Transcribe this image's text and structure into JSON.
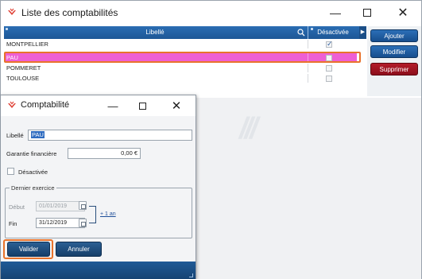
{
  "main_window": {
    "title": "Liste des comptabilités",
    "controls": {
      "minimize": "—",
      "close": "✕"
    }
  },
  "grid": {
    "columns": {
      "libelle": "Libellé",
      "desactivee": "Désactivée"
    },
    "rows": [
      {
        "label": "MONTPELLIER",
        "desactivee": true,
        "selected": false
      },
      {
        "label": "PAU",
        "desactivee": false,
        "selected": true
      },
      {
        "label": "POMMERET",
        "desactivee": false,
        "selected": false
      },
      {
        "label": "TOULOUSE",
        "desactivee": false,
        "selected": false
      }
    ]
  },
  "side_buttons": {
    "ajouter": "Ajouter",
    "modifier": "Modifier",
    "supprimer": "Supprimer"
  },
  "dialog": {
    "title": "Comptabilité",
    "controls": {
      "minimize": "—",
      "close": "✕"
    },
    "libelle_label": "Libellé",
    "libelle_value": "PAU",
    "garantie_label": "Garantie financière",
    "garantie_value": "0,00 €",
    "desactivee_label": "Désactivée",
    "desactivee_checked": false,
    "exercice": {
      "legend": "Dernier exercice",
      "debut_label": "Début",
      "debut_value": "01/01/2019",
      "fin_label": "Fin",
      "fin_value": "31/12/2019",
      "plus_link": "+ 1 an"
    },
    "buttons": {
      "valider": "Valider",
      "annuler": "Annuler"
    }
  },
  "colors": {
    "header_blue": "#1d5796",
    "selected_row": "#ee5fd4",
    "highlight_outline": "#e8732c",
    "delete_red": "#a01522"
  }
}
